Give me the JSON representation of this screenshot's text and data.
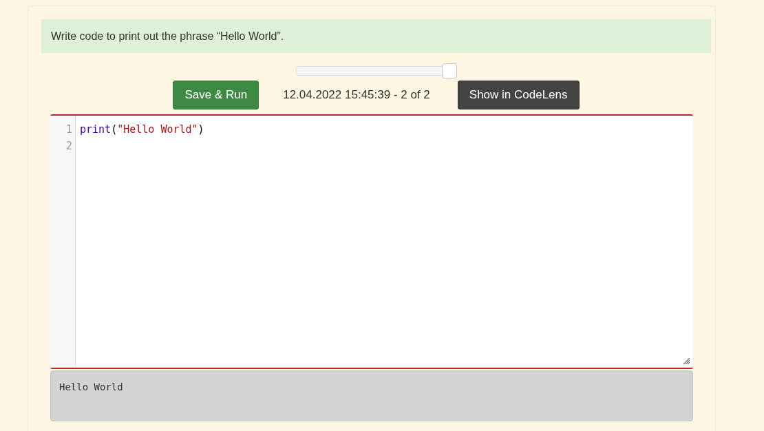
{
  "prompt": "Write code to print out the phrase “Hello World”.",
  "history_slider": {
    "level": 1
  },
  "run_button": "Save & Run",
  "timestamp": "12.04.2022 15:45:39 - 2 of 2",
  "codelens_button": "Show in CodeLens",
  "editor": {
    "lines": [
      {
        "number": "1",
        "tokens": [
          {
            "kind": "builtin",
            "text": "print"
          },
          {
            "kind": "punct",
            "text": "("
          },
          {
            "kind": "string",
            "text": "\"Hello World\""
          },
          {
            "kind": "punct",
            "text": ")"
          }
        ]
      },
      {
        "number": "2"
      }
    ]
  },
  "output": "Hello World"
}
